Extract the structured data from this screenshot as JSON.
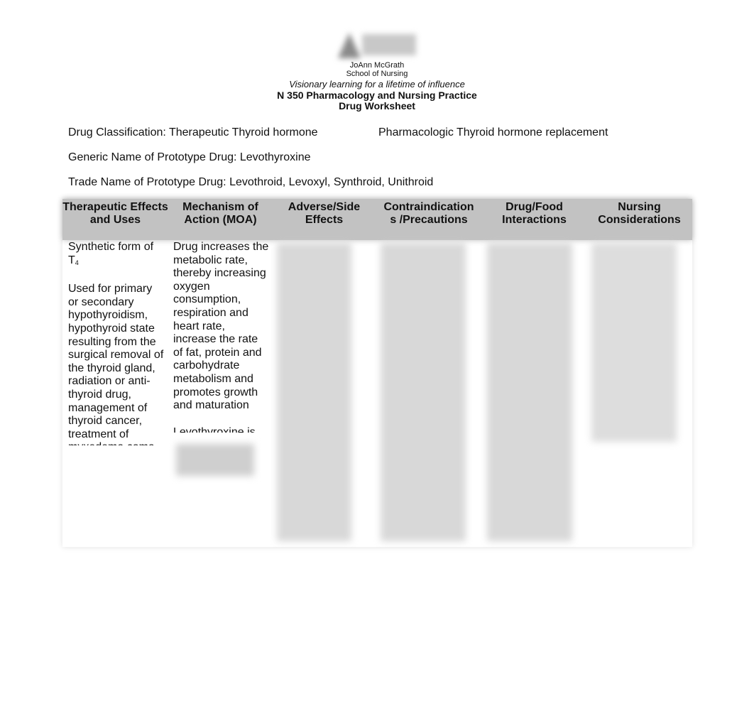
{
  "header": {
    "logo": "school-logo",
    "institution_line1": "JoAnn McGrath",
    "institution_line2": "School of Nursing",
    "motto": "Visionary learning for a lifetime of influence",
    "course": "N 350 Pharmacology and Nursing Practice",
    "worksheet_title": "Drug Worksheet"
  },
  "drug_info": {
    "classification": "Drug Classification: Therapeutic Thyroid hormone",
    "pharmacologic": "Pharmacologic Thyroid hormone replacement",
    "generic_name": "Generic Name of Prototype Drug: Levothyroxine",
    "trade_name": "Trade Name of Prototype Drug: Levothroid, Levoxyl, Synthroid, Unithroid"
  },
  "table": {
    "headers": [
      "Therapeutic Effects and Uses",
      "Mechanism of Action (MOA)",
      "Adverse/Side Effects",
      "Contraindications /Precautions",
      "Drug/Food Interactions",
      "Nursing Considerations"
    ],
    "therapeutic": {
      "p1": "Synthetic form of T",
      "p1_sub": "4",
      "p2": "Used for primary or secondary hypothyroidism, hypothyroid state resulting from the surgical removal of the thyroid gland, radiation or anti-thyroid drug, management of thyroid cancer, treatment of myxedema coma"
    },
    "moa": {
      "p1": "Drug increases the metabolic rate, thereby increasing oxygen consumption, respiration and heart rate, increase the rate of fat, protein and carbohydrate metabolism and promotes growth and maturation",
      "p2": "Levothyroxine is"
    },
    "blurred_note": "content obscured"
  }
}
